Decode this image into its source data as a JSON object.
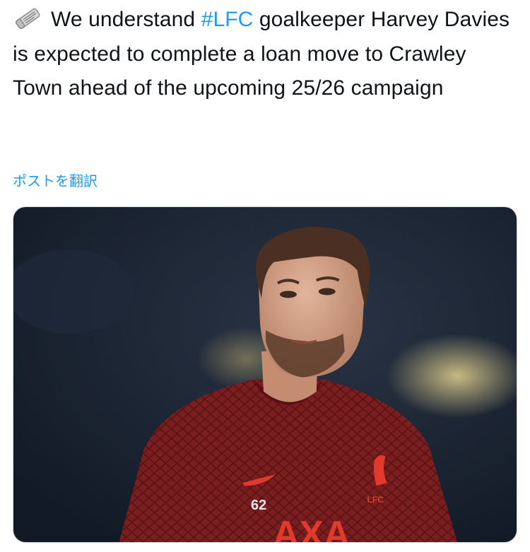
{
  "tweet": {
    "text_before_hashtag": "We understand ",
    "hashtag": "#LFC",
    "text_after_hashtag": " goalkeeper Harvey Davies is expected to complete a loan move to Crawley Town ahead of the upcoming 25/26 campaign",
    "emoji_icon": "rolled-newspaper-icon",
    "translate_label": "ポストを翻訳"
  },
  "media": {
    "kit_number": "62",
    "badge_text": "LFC",
    "sponsor_text": "AXA",
    "colors": {
      "link": "#1d9bf0",
      "shirt": "#7a1e20",
      "background": "#1b2433"
    }
  }
}
